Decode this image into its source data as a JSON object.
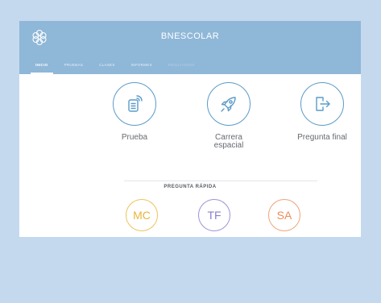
{
  "app": {
    "title": "BNESCOLAR",
    "logo_icon": "hexagon-flower-logo"
  },
  "tabs": [
    {
      "label": "INICIO",
      "active": true
    },
    {
      "label": "PRUEBAS",
      "active": false
    },
    {
      "label": "CLASES",
      "active": false
    },
    {
      "label": "INFORMES",
      "active": false
    },
    {
      "label": "RESULTADOS",
      "active": false
    }
  ],
  "actions": [
    {
      "label": "Prueba",
      "icon": "document-broadcast-icon"
    },
    {
      "label_line1": "Carrera",
      "label_line2": "espacial",
      "icon": "rocket-icon"
    },
    {
      "label": "Pregunta final",
      "icon": "exit-arrow-icon"
    }
  ],
  "quick_question": {
    "title": "PREGUNTA RÁPIDA",
    "options": [
      {
        "label": "MC",
        "color": "#e9b43a"
      },
      {
        "label": "TF",
        "color": "#8a80cf"
      },
      {
        "label": "SA",
        "color": "#ec8c5a"
      }
    ]
  },
  "colors": {
    "header": "#8fb7d8",
    "background": "#c5d9ee",
    "icon_stroke": "#5b9bc9"
  }
}
